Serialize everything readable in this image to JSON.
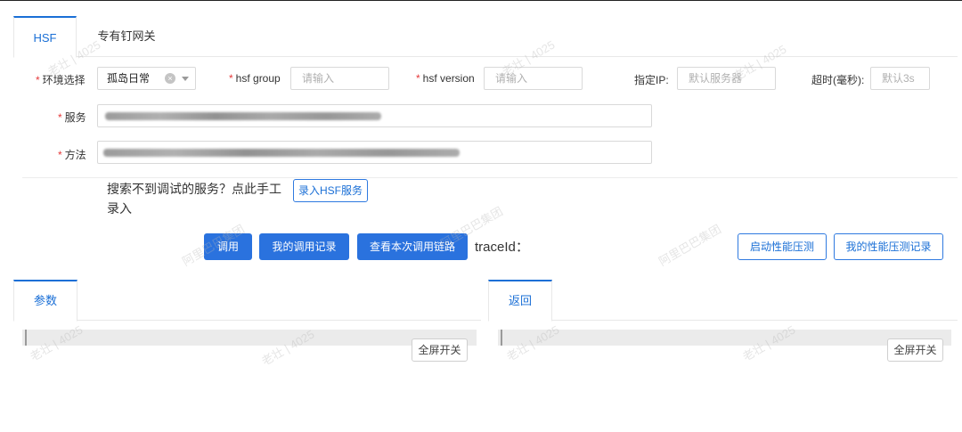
{
  "tabs": [
    {
      "label": "HSF",
      "active": true
    },
    {
      "label": "专有钉网关",
      "active": false
    }
  ],
  "form": {
    "env": {
      "label": "环境选择",
      "value": "孤岛日常"
    },
    "hsf_group": {
      "label": "hsf group",
      "placeholder": "请输入"
    },
    "hsf_version": {
      "label": "hsf version",
      "placeholder": "请输入"
    },
    "ip": {
      "label": "指定IP:",
      "placeholder": "默认服务器"
    },
    "timeout": {
      "label": "超时(毫秒):",
      "placeholder": "默认3s"
    },
    "service": {
      "label": "服务"
    },
    "method": {
      "label": "方法"
    },
    "required_mark": "*"
  },
  "hint": {
    "text": "搜索不到调试的服务？点此手工录入",
    "button": "录入HSF服务"
  },
  "actions": {
    "invoke": "调用",
    "my_records": "我的调用记录",
    "view_trace": "查看本次调用链路",
    "trace_label": "traceId：",
    "start_perf": "启动性能压测",
    "my_perf": "我的性能压测记录"
  },
  "panels": {
    "params": {
      "tab": "参数",
      "fullscreen": "全屏开关"
    },
    "result": {
      "tab": "返回",
      "fullscreen": "全屏开关"
    }
  },
  "watermark": [
    "老壮 | 4025",
    "阿里巴巴集团"
  ],
  "colors": {
    "primary": "#2a72de",
    "required": "#e5393a",
    "active_tab": "#1a6fd6"
  }
}
